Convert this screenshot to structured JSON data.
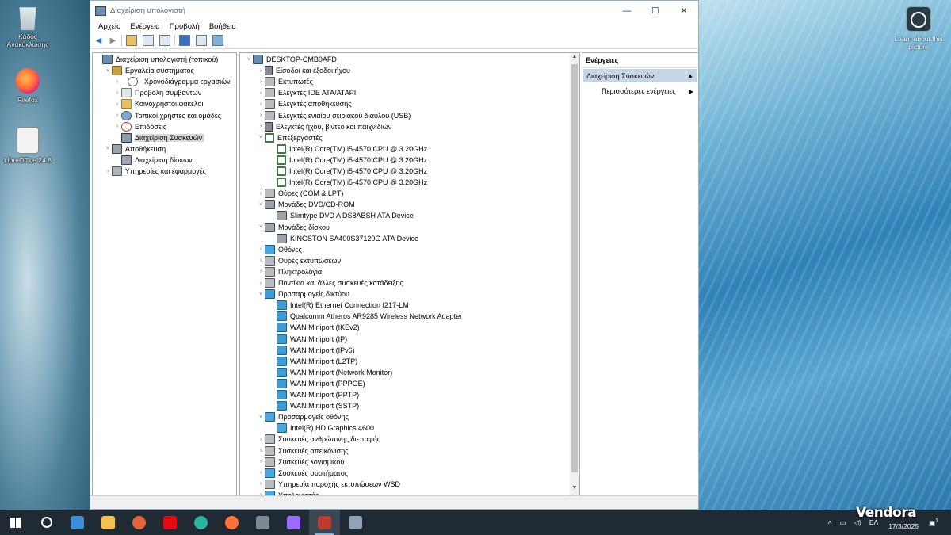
{
  "desktop": {
    "icons": [
      {
        "label": "Κάδος Ανακύκλωσης",
        "icon": "recycle-bin-icon"
      },
      {
        "label": "Firefox",
        "icon": "firefox-icon"
      },
      {
        "label": "LibreOffice 24.8",
        "icon": "libreoffice-icon"
      }
    ],
    "learn_label": "Learn about this picture"
  },
  "window": {
    "title": "Διαχείριση υπολογιστή",
    "controls": {
      "minimize": "—",
      "maximize": "☐",
      "close": "✕"
    }
  },
  "menu": [
    "Αρχείο",
    "Ενέργεια",
    "Προβολή",
    "Βοήθεια"
  ],
  "left_tree": [
    {
      "label": "Διαχείριση υπολογιστή (τοπικού)",
      "icon": "comp",
      "level": 0,
      "chev": ""
    },
    {
      "label": "Εργαλεία συστήματος",
      "icon": "tool",
      "level": 1,
      "chev": "˅"
    },
    {
      "label": "Χρονοδιάγραμμα εργασιών",
      "icon": "clock",
      "level": 2,
      "chev": "›"
    },
    {
      "label": "Προβολή συμβάντων",
      "icon": "log",
      "level": 2,
      "chev": "›"
    },
    {
      "label": "Κοινόχρηστοι φάκελοι",
      "icon": "folder",
      "level": 2,
      "chev": "›"
    },
    {
      "label": "Τοπικοί χρήστες και ομάδες",
      "icon": "users",
      "level": 2,
      "chev": "›"
    },
    {
      "label": "Επιδόσεις",
      "icon": "perf",
      "level": 2,
      "chev": "›"
    },
    {
      "label": "Διαχείριση Συσκευών",
      "icon": "dev",
      "level": 2,
      "chev": "",
      "selected": true
    },
    {
      "label": "Αποθήκευση",
      "icon": "disk",
      "level": 1,
      "chev": "˅"
    },
    {
      "label": "Διαχείριση δίσκων",
      "icon": "disk",
      "level": 2,
      "chev": ""
    },
    {
      "label": "Υπηρεσίες και εφαρμογές",
      "icon": "svc",
      "level": 1,
      "chev": "›"
    }
  ],
  "device_tree": [
    {
      "label": "DESKTOP-CMB0AFD",
      "icon": "comp",
      "level": 0,
      "chev": "˅"
    },
    {
      "label": "Είσοδοι και έξοδοι ήχου",
      "icon": "audio",
      "level": 1,
      "chev": "›"
    },
    {
      "label": "Εκτυπωτές",
      "icon": "gray",
      "level": 1,
      "chev": "›"
    },
    {
      "label": "Ελεγκτές IDE ATA/ATAPI",
      "icon": "gray",
      "level": 1,
      "chev": "›"
    },
    {
      "label": "Ελεγκτές αποθήκευσης",
      "icon": "gray",
      "level": 1,
      "chev": "›"
    },
    {
      "label": "Ελεγκτές ενιαίου σειριακού διαύλου (USB)",
      "icon": "gray",
      "level": 1,
      "chev": "›"
    },
    {
      "label": "Ελεγκτές ήχου, βίντεο και παιχνιδιών",
      "icon": "audio",
      "level": 1,
      "chev": "›"
    },
    {
      "label": "Επεξεργαστές",
      "icon": "cpu",
      "level": 1,
      "chev": "˅"
    },
    {
      "label": "Intel(R) Core(TM) i5-4570 CPU @ 3.20GHz",
      "icon": "cpu",
      "level": 2,
      "chev": ""
    },
    {
      "label": "Intel(R) Core(TM) i5-4570 CPU @ 3.20GHz",
      "icon": "cpu",
      "level": 2,
      "chev": ""
    },
    {
      "label": "Intel(R) Core(TM) i5-4570 CPU @ 3.20GHz",
      "icon": "cpu",
      "level": 2,
      "chev": ""
    },
    {
      "label": "Intel(R) Core(TM) i5-4570 CPU @ 3.20GHz",
      "icon": "cpu",
      "level": 2,
      "chev": ""
    },
    {
      "label": "Θύρες (COM & LPT)",
      "icon": "gray",
      "level": 1,
      "chev": "›"
    },
    {
      "label": "Μονάδες DVD/CD-ROM",
      "icon": "disk",
      "level": 1,
      "chev": "˅"
    },
    {
      "label": "Slimtype DVD A  DS8ABSH ATA Device",
      "icon": "disk",
      "level": 2,
      "chev": ""
    },
    {
      "label": "Μονάδες δίσκου",
      "icon": "disk",
      "level": 1,
      "chev": "˅"
    },
    {
      "label": "KINGSTON SA400S37120G ATA Device",
      "icon": "disk",
      "level": 2,
      "chev": ""
    },
    {
      "label": "Οθόνες",
      "icon": "monitor",
      "level": 1,
      "chev": "›"
    },
    {
      "label": "Ουρές εκτυπώσεων",
      "icon": "gray",
      "level": 1,
      "chev": "›"
    },
    {
      "label": "Πληκτρολόγια",
      "icon": "gray",
      "level": 1,
      "chev": "›"
    },
    {
      "label": "Ποντίκια και άλλες συσκευές κατάδειξης",
      "icon": "gray",
      "level": 1,
      "chev": "›"
    },
    {
      "label": "Προσαρμογείς δικτύου",
      "icon": "net",
      "level": 1,
      "chev": "˅"
    },
    {
      "label": "Intel(R) Ethernet Connection I217-LM",
      "icon": "net",
      "level": 2,
      "chev": ""
    },
    {
      "label": "Qualcomm Atheros AR9285 Wireless Network Adapter",
      "icon": "net",
      "level": 2,
      "chev": ""
    },
    {
      "label": "WAN Miniport (IKEv2)",
      "icon": "net",
      "level": 2,
      "chev": ""
    },
    {
      "label": "WAN Miniport (IP)",
      "icon": "net",
      "level": 2,
      "chev": ""
    },
    {
      "label": "WAN Miniport (IPv6)",
      "icon": "net",
      "level": 2,
      "chev": ""
    },
    {
      "label": "WAN Miniport (L2TP)",
      "icon": "net",
      "level": 2,
      "chev": ""
    },
    {
      "label": "WAN Miniport (Network Monitor)",
      "icon": "net",
      "level": 2,
      "chev": ""
    },
    {
      "label": "WAN Miniport (PPPOE)",
      "icon": "net",
      "level": 2,
      "chev": ""
    },
    {
      "label": "WAN Miniport (PPTP)",
      "icon": "net",
      "level": 2,
      "chev": ""
    },
    {
      "label": "WAN Miniport (SSTP)",
      "icon": "net",
      "level": 2,
      "chev": ""
    },
    {
      "label": "Προσαρμογείς οθόνης",
      "icon": "monitor",
      "level": 1,
      "chev": "˅"
    },
    {
      "label": "Intel(R) HD Graphics 4600",
      "icon": "monitor",
      "level": 2,
      "chev": ""
    },
    {
      "label": "Συσκευές ανθρώπινης διεπαφής",
      "icon": "gray",
      "level": 1,
      "chev": "›"
    },
    {
      "label": "Συσκευές απεικόνισης",
      "icon": "gray",
      "level": 1,
      "chev": "›"
    },
    {
      "label": "Συσκευές λογισμικού",
      "icon": "gray",
      "level": 1,
      "chev": "›"
    },
    {
      "label": "Συσκευές συστήματος",
      "icon": "monitor",
      "level": 1,
      "chev": "›"
    },
    {
      "label": "Υπηρεσία παροχής εκτυπώσεων WSD",
      "icon": "gray",
      "level": 1,
      "chev": "›"
    },
    {
      "label": "Υπολογιστής",
      "icon": "monitor",
      "level": 1,
      "chev": "›"
    }
  ],
  "actions": {
    "header": "Ενέργειες",
    "section": "Διαχείριση Συσκευών",
    "more": "Περισσότερες ενέργειες"
  },
  "taskbar": {
    "apps": [
      {
        "name": "start-button",
        "color": "#ffffff"
      },
      {
        "name": "search-button",
        "color": "#ffffff"
      },
      {
        "name": "store-app",
        "color": "#3a8fd8"
      },
      {
        "name": "explorer-app",
        "color": "#f2c14e"
      },
      {
        "name": "media-player-app",
        "color": "#e8623a"
      },
      {
        "name": "netflix-app",
        "color": "#e50914"
      },
      {
        "name": "edge-app",
        "color": "#2ab5a0"
      },
      {
        "name": "firefox-app",
        "color": "#ff7139"
      },
      {
        "name": "calculator-app",
        "color": "#7c8a96"
      },
      {
        "name": "copilot-app",
        "color": "#9b6bff"
      },
      {
        "name": "computer-management-app",
        "color": "#c0392b"
      },
      {
        "name": "device-app",
        "color": "#8fa3b8"
      }
    ],
    "lang": "ΕΛ",
    "date": "17/3/2025",
    "notifications": "1"
  },
  "watermark": "Vendora"
}
